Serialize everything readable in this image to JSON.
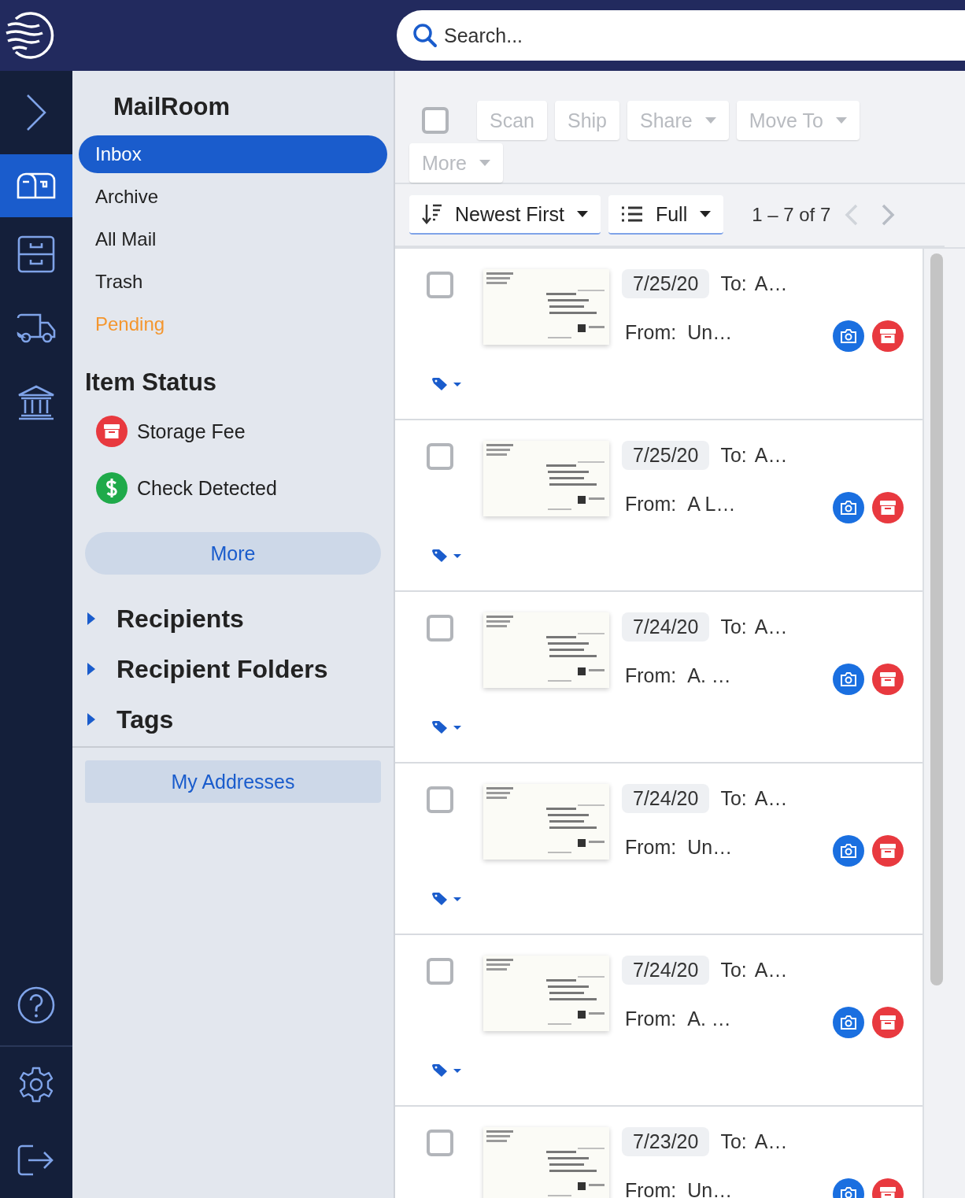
{
  "search": {
    "placeholder": "Search..."
  },
  "nav_rail": [
    {
      "kind": "expand",
      "selected": false
    },
    {
      "kind": "mailbox",
      "selected": true
    },
    {
      "kind": "cabinet",
      "selected": false
    },
    {
      "kind": "truck",
      "selected": false
    },
    {
      "kind": "bank",
      "selected": false
    },
    {
      "kind": "help",
      "selected": false
    },
    {
      "kind": "settings",
      "selected": false
    },
    {
      "kind": "logout",
      "selected": false
    }
  ],
  "sidebar": {
    "title": "MailRoom",
    "folders": [
      {
        "label": "Inbox",
        "selected": true,
        "pending": false
      },
      {
        "label": "Archive",
        "selected": false,
        "pending": false
      },
      {
        "label": "All Mail",
        "selected": false,
        "pending": false
      },
      {
        "label": "Trash",
        "selected": false,
        "pending": false
      },
      {
        "label": "Pending",
        "selected": false,
        "pending": true
      }
    ],
    "item_status_title": "Item Status",
    "item_status": [
      {
        "kind": "storage",
        "label": "Storage Fee"
      },
      {
        "kind": "check",
        "label": "Check Detected"
      }
    ],
    "more_button": "More",
    "sections": [
      {
        "label": "Recipients",
        "expanded": false
      },
      {
        "label": "Recipient Folders",
        "expanded": false
      },
      {
        "label": "Tags",
        "expanded": false
      }
    ],
    "addresses_button": "My Addresses"
  },
  "toolbar": {
    "select_all_checked": false,
    "actions": [
      {
        "label": "Scan",
        "disabled": true,
        "dropdown": false
      },
      {
        "label": "Ship",
        "disabled": true,
        "dropdown": false
      },
      {
        "label": "Share",
        "disabled": true,
        "dropdown": true
      },
      {
        "label": "Move To",
        "disabled": true,
        "dropdown": true
      },
      {
        "label": "More",
        "disabled": true,
        "dropdown": true
      }
    ],
    "sort": "Newest First",
    "view": "Full",
    "pagination": "1 – 7 of 7"
  },
  "items": [
    {
      "checked": false,
      "date": "7/25/20",
      "to_label": "To:",
      "to": "A…",
      "from_label": "From:",
      "from": "Un…"
    },
    {
      "checked": false,
      "date": "7/25/20",
      "to_label": "To:",
      "to": "A…",
      "from_label": "From:",
      "from": "A L…"
    },
    {
      "checked": false,
      "date": "7/24/20",
      "to_label": "To:",
      "to": "A…",
      "from_label": "From:",
      "from": "A. …"
    },
    {
      "checked": false,
      "date": "7/24/20",
      "to_label": "To:",
      "to": "A…",
      "from_label": "From:",
      "from": "Un…"
    },
    {
      "checked": false,
      "date": "7/24/20",
      "to_label": "To:",
      "to": "A…",
      "from_label": "From:",
      "from": "A. …"
    },
    {
      "checked": false,
      "date": "7/23/20",
      "to_label": "To:",
      "to": "A…",
      "from_label": "From:",
      "from": "Un…"
    }
  ]
}
